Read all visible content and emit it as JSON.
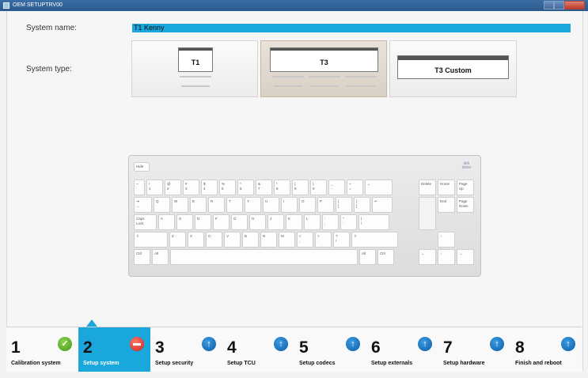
{
  "window": {
    "title": "OEM SETUPTRV00"
  },
  "form": {
    "system_name_label": "System name:",
    "system_name_value": "T1 Kenny",
    "system_type_label": "System type:",
    "system_types": [
      {
        "label": "T1",
        "selected": false
      },
      {
        "label": "T3",
        "selected": true
      },
      {
        "label": "T3 Custom",
        "selected": false
      }
    ]
  },
  "keyboard": {
    "brand": "cisco",
    "hide_label": "Hide"
  },
  "steps": [
    {
      "number": "1",
      "label": "Calibration system",
      "status": "done",
      "icon": "check-icon"
    },
    {
      "number": "2",
      "label": "Setup system",
      "status": "active",
      "icon": "minus-icon"
    },
    {
      "number": "3",
      "label": "Setup security",
      "status": "pending",
      "icon": "arrow-up-icon"
    },
    {
      "number": "4",
      "label": "Setup TCU",
      "status": "pending",
      "icon": "arrow-up-icon"
    },
    {
      "number": "5",
      "label": "Setup codecs",
      "status": "pending",
      "icon": "arrow-up-icon"
    },
    {
      "number": "6",
      "label": "Setup externals",
      "status": "pending",
      "icon": "arrow-up-icon"
    },
    {
      "number": "7",
      "label": "Setup hardware",
      "status": "pending",
      "icon": "arrow-up-icon"
    },
    {
      "number": "8",
      "label": "Finish and reboot",
      "status": "pending",
      "icon": "arrow-up-icon"
    }
  ],
  "colors": {
    "accent": "#1aa7dc",
    "check": "#3f9a18",
    "stop": "#d0201a",
    "arrow": "#0a5ca8"
  }
}
